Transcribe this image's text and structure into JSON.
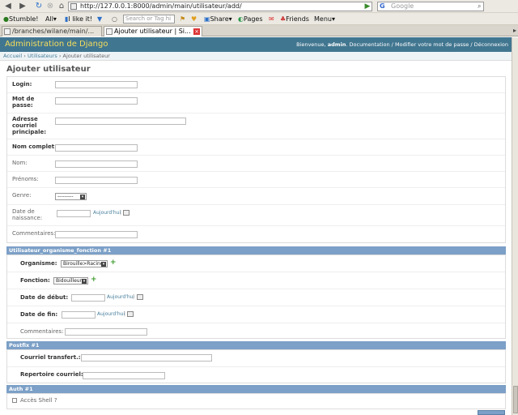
{
  "browser": {
    "url": "http://127.0.0.1:8000/admin/main/utilisateur/add/",
    "search_placeholder": "Google",
    "search_engine_letter": "G",
    "toolbar": {
      "stumble": "Stumble!",
      "all": "All▾",
      "like": "I like it!",
      "tag_search_placeholder": "Search or Tag hi",
      "share": "Share▾",
      "pages": "Pages",
      "friends": "Friends",
      "menu": "Menu▾"
    },
    "tabs": [
      {
        "label": "/branches/wilane/main/..."
      },
      {
        "label": "Ajouter utilisateur | Si..."
      }
    ]
  },
  "admin": {
    "branding": "Administration de Django",
    "welcome": "Bienvenue,",
    "username": "admin",
    "user_links": ". Documentation / Modifier votre mot de passe / Déconnexion",
    "breadcrumbs": {
      "home": "Accueil",
      "section": "Utilisateurs",
      "current": "Ajouter utilisateur",
      "sep": " › "
    },
    "title": "Ajouter utilisateur"
  },
  "form": {
    "login": "Login:",
    "password_l1": "Mot de",
    "password_l2": "passe:",
    "email_l1": "Adresse",
    "email_l2": "courriel",
    "email_l3": "principale:",
    "fullname": "Nom complet:",
    "nom": "Nom:",
    "prenoms": "Prénoms:",
    "genre": "Genre:",
    "genre_value": "---------",
    "birth_l1": "Date de",
    "birth_l2": "naissance:",
    "today": "Aujourd'hui",
    "comments": "Commentaires:"
  },
  "inline1": {
    "title": "Utilisateur_organisme_fonction #1",
    "organisme": "Organisme:",
    "organisme_value": "Birouille>Racine",
    "fonction": "Fonction:",
    "fonction_value": "Bidouilleur",
    "start": "Date de début:",
    "end": "Date de fin:",
    "today": "Aujourd'hui",
    "comments": "Commentaires:"
  },
  "inline2": {
    "title": "Postfix #1",
    "transfer": "Courriel transfert.:",
    "mailbox": "Repertoire courriel:"
  },
  "inline3": {
    "title": "Auth #1",
    "shell": "Accès Shell ?"
  }
}
